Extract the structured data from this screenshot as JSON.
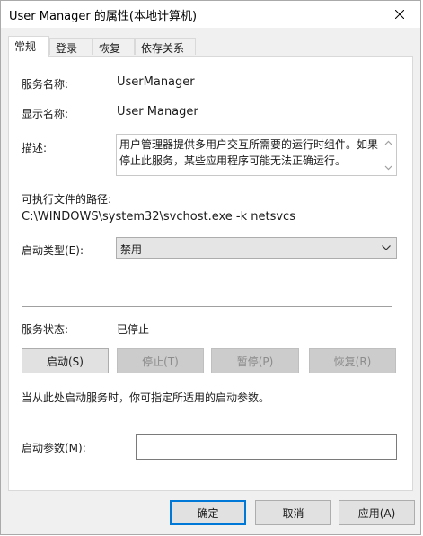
{
  "window": {
    "title": "User Manager 的属性(本地计算机)"
  },
  "tabs": [
    {
      "label": "常规"
    },
    {
      "label": "登录"
    },
    {
      "label": "恢复"
    },
    {
      "label": "依存关系"
    }
  ],
  "general": {
    "service_name_label": "服务名称:",
    "service_name_value": "UserManager",
    "display_name_label": "显示名称:",
    "display_name_value": "User Manager",
    "description_label": "描述:",
    "description_value": "用户管理器提供多用户交互所需要的运行时组件。如果停止此服务，某些应用程序可能无法正确运行。",
    "exe_path_label": "可执行文件的路径:",
    "exe_path_value": "C:\\WINDOWS\\system32\\svchost.exe -k netsvcs",
    "startup_type_label": "启动类型(E):",
    "startup_type_value": "禁用",
    "service_status_label": "服务状态:",
    "service_status_value": "已停止",
    "buttons": {
      "start": "启动(S)",
      "stop": "停止(T)",
      "pause": "暂停(P)",
      "resume": "恢复(R)"
    },
    "hint_text": "当从此处启动服务时，你可指定所适用的启动参数。",
    "start_params_label": "启动参数(M):",
    "start_params_value": ""
  },
  "footer": {
    "ok": "确定",
    "cancel": "取消",
    "apply": "应用(A)"
  },
  "colors": {
    "accent": "#0078d7",
    "dialog_bg": "#f0f0f0",
    "panel_bg": "#ffffff"
  }
}
